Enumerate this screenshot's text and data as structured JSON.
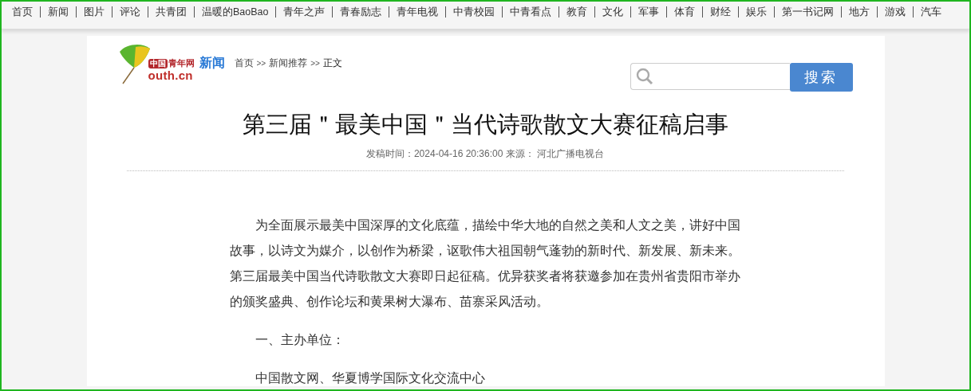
{
  "nav": {
    "items": [
      "首页",
      "新闻",
      "图片",
      "评论",
      "共青团",
      "温暖的BaoBao",
      "青年之声",
      "青春励志",
      "青年电视",
      "中青校园",
      "中青看点",
      "教育",
      "文化",
      "军事",
      "体育",
      "财经",
      "娱乐",
      "第一书记网",
      "地方",
      "游戏",
      "汽车"
    ]
  },
  "logo": {
    "badge": "中国",
    "name": "青年网",
    "domain": "outh.cn"
  },
  "channel": "新闻",
  "breadcrumb": [
    {
      "label": "首页",
      "kind": "link"
    },
    {
      "label": ">>",
      "kind": "sep"
    },
    {
      "label": "新闻推荐",
      "kind": "link"
    },
    {
      "label": ">>",
      "kind": "sep"
    },
    {
      "label": "正文",
      "kind": "current"
    }
  ],
  "search": {
    "button": "搜索"
  },
  "article": {
    "title": "第三届＂最美中国＂当代诗歌散文大赛征稿启事",
    "meta": "发稿时间：2024-04-16 20:36:00 来源： 河北广播电视台",
    "paragraphs": [
      "为全面展示最美中国深厚的文化底蕴，描绘中华大地的自然之美和人文之美，讲好中国故事，以诗文为媒介，以创作为桥梁，讴歌伟大祖国朝气蓬勃的新时代、新发展、新未来。第三届最美中国当代诗歌散文大赛即日起征稿。优异获奖者将获邀参加在贵州省贵阳市举办的颁奖盛典、创作论坛和黄果树大瀑布、苗寨采风活动。",
      "一、主办单位：",
      "中国散文网、华夏博学国际文化交流中心"
    ]
  }
}
